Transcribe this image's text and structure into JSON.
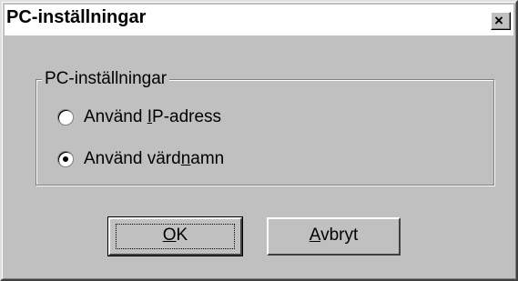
{
  "window": {
    "title": "PC-inställningar",
    "close_label": "×"
  },
  "group": {
    "label": "PC-inställningar"
  },
  "options": [
    {
      "pre": "Använd ",
      "mnemonic": "I",
      "post": "P-adress",
      "selected": false
    },
    {
      "pre": "Använd värd",
      "mnemonic": "n",
      "post": "amn",
      "selected": true
    }
  ],
  "buttons": {
    "ok": {
      "mnemonic": "O",
      "rest": "K"
    },
    "cancel": {
      "mnemonic": "A",
      "rest": "vbryt"
    }
  },
  "icons": {
    "close": "close-icon",
    "radio": "radio-button"
  },
  "colors": {
    "dialog_face": "#c0c0c0",
    "title_bar": "#ffffff",
    "text": "#000000"
  }
}
